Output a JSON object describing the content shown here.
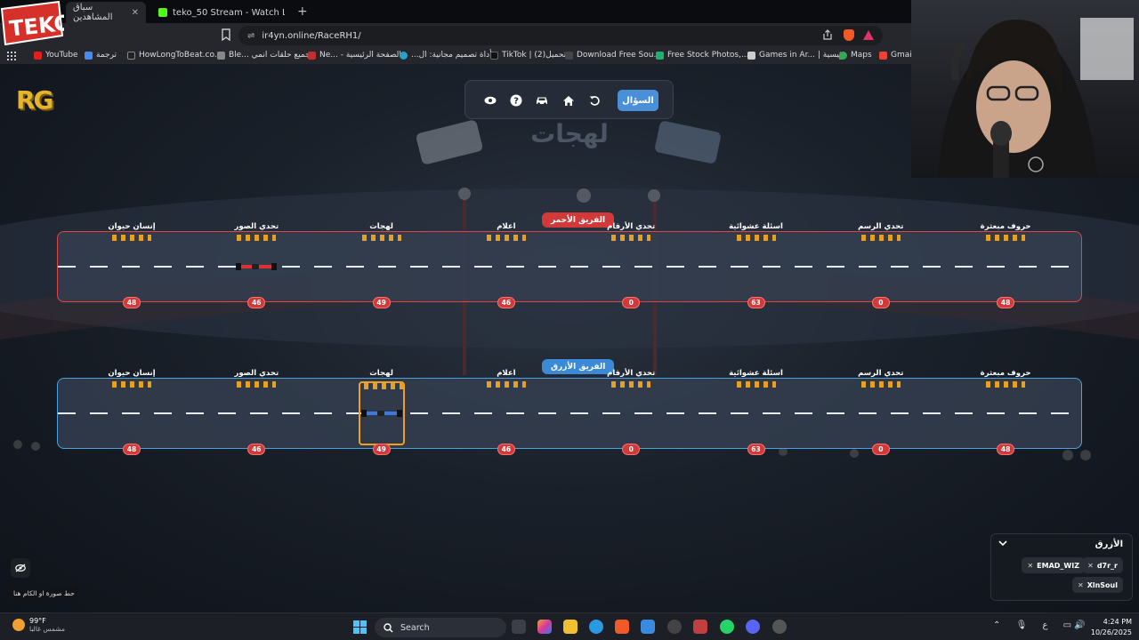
{
  "browser": {
    "tabs": [
      {
        "label": "سباق المشاهدين",
        "active": true
      },
      {
        "label": "teko_50 Stream - Watch Live on Kick",
        "active": false
      }
    ],
    "url": "ir4yn.online/RaceRH1/",
    "bookmarks": [
      {
        "label": "YouTube",
        "color": "#e02020"
      },
      {
        "label": "ترجمة",
        "color": "#4a8af0"
      },
      {
        "label": "HowLongToBeat.co...",
        "color": "#222222"
      },
      {
        "label": "جميع حلقات انمي ...Ble",
        "color": "#888888"
      },
      {
        "label": "الصفحة الرئيسية - ...Ne",
        "color": "#c03030"
      },
      {
        "label": "أداة تصميم مجانية: ال...",
        "color": "#28a0c8"
      },
      {
        "label": "TikTok | (2)تحميل",
        "color": "#111111"
      },
      {
        "label": "Download Free Sou...",
        "color": "#444444"
      },
      {
        "label": "Free Stock Photos,...",
        "color": "#20b070"
      },
      {
        "label": "Games in Ar... | رئيسية",
        "color": "#cccccc"
      },
      {
        "label": "Maps",
        "color": "#34a853"
      },
      {
        "label": "Gmail",
        "color": "#ea4335"
      }
    ]
  },
  "game": {
    "toolbar": {
      "question_label": "السؤال"
    },
    "title": "لهجات",
    "red_team": {
      "label": "الفريق الأحمر"
    },
    "blue_team": {
      "label": "الفريق الأزرق"
    },
    "stops": [
      {
        "label": "إنسان حيوان",
        "score": "48"
      },
      {
        "label": "تحدي الصور",
        "score": "46"
      },
      {
        "label": "لهجات",
        "score": "49"
      },
      {
        "label": "اعلام",
        "score": "46"
      },
      {
        "label": "تحدي الأرقام",
        "score": "0"
      },
      {
        "label": "اسئلة عشوائية",
        "score": "63"
      },
      {
        "label": "تحدي الرسم",
        "score": "0"
      },
      {
        "label": "حروف مبعثرة",
        "score": "48"
      }
    ],
    "red_car_stop": 1,
    "blue_car_stop": 2,
    "active_blue_stop": 2,
    "camera_hint": "حط صورة او الكام هنا",
    "team_panel": {
      "title": "الأزرق",
      "players": [
        "d7r_r",
        "EMAD_WIZ",
        "XlnSoul"
      ]
    }
  },
  "taskbar": {
    "weather_temp": "99°F",
    "weather_desc": "مشمس غالبا",
    "search_placeholder": "Search",
    "lang": "ع",
    "time": "4:24 PM",
    "date": "10/26/2025"
  }
}
